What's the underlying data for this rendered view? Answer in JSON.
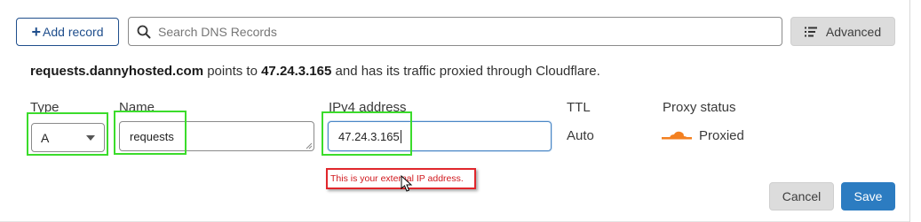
{
  "toolbar": {
    "add_record_label": "Add record",
    "search_placeholder": "Search DNS Records",
    "advanced_label": "Advanced"
  },
  "info": {
    "domain": "requests.dannyhosted.com",
    "text_1": " points to ",
    "ip": "47.24.3.165",
    "text_2": " and has its traffic proxied through Cloudflare."
  },
  "form": {
    "type_label": "Type",
    "type_value": "A",
    "name_label": "Name",
    "name_value": "requests",
    "ipv4_label": "IPv4 address",
    "ipv4_value": "47.24.3.165",
    "ttl_label": "TTL",
    "ttl_value": "Auto",
    "proxy_label": "Proxy status",
    "proxy_value": "Proxied"
  },
  "tooltip": {
    "text": "This is your external IP address."
  },
  "actions": {
    "cancel_label": "Cancel",
    "save_label": "Save"
  },
  "colors": {
    "primary": "#2c7cc1",
    "add_button": "#1f4e8c",
    "highlight": "#3bdc2b",
    "tooltip_border": "#e0262b",
    "proxy_orange": "#f38020"
  },
  "icons": {
    "search": "search-icon",
    "advanced": "list-filter-icon",
    "type_caret": "chevron-down-icon",
    "proxy": "cloud-icon",
    "mouse": "mouse-pointer-icon"
  }
}
